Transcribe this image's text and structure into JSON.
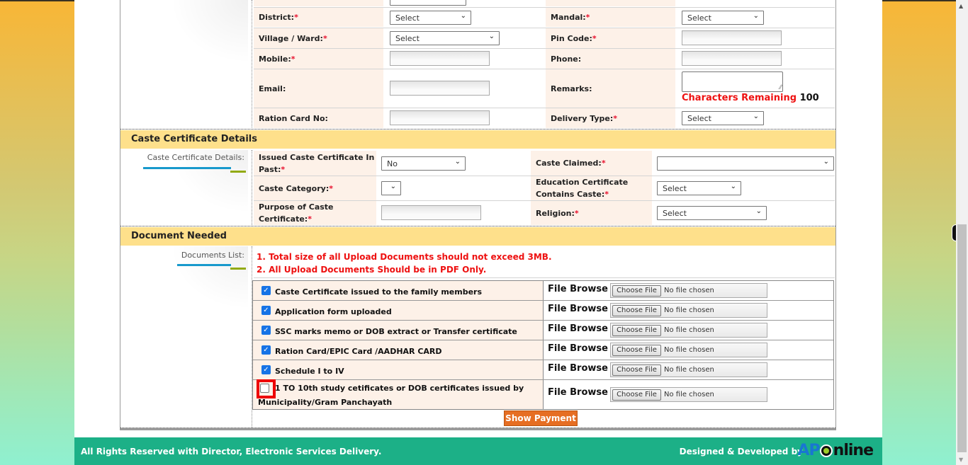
{
  "address": {
    "district": {
      "label": "District:",
      "required": "*",
      "value": "Select"
    },
    "mandal": {
      "label": "Mandal:",
      "required": "*",
      "value": "Select"
    },
    "village": {
      "label": "Village / Ward:",
      "required": "*",
      "value": "Select"
    },
    "pincode": {
      "label": "Pin Code:",
      "required": "*",
      "value": ""
    },
    "mobile": {
      "label": "Mobile:",
      "required": "*",
      "value": ""
    },
    "phone": {
      "label": "Phone:",
      "value": ""
    },
    "email": {
      "label": "Email:",
      "value": ""
    },
    "remarks": {
      "label": "Remarks:",
      "value": "",
      "chars_label": "Characters Remaining",
      "chars_count": "100"
    },
    "ration": {
      "label": "Ration Card No:",
      "value": ""
    },
    "delivery": {
      "label": "Delivery Type:",
      "required": "*",
      "value": "Select"
    }
  },
  "caste": {
    "title": "Caste Certificate Details",
    "side_label": "Caste Certificate Details:",
    "issued_past": {
      "label_line1": "Issued Caste Certificate In",
      "label_line2": "Past:",
      "required": "*",
      "value": "No"
    },
    "caste_claimed": {
      "label": "Caste Claimed:",
      "required": "*",
      "value": ""
    },
    "caste_category": {
      "label": "Caste Category:",
      "required": "*",
      "value": ""
    },
    "edu_cert": {
      "label_line1": "Education Certificate",
      "label_line2": "Contains Caste:",
      "required": "*",
      "value": "Select"
    },
    "purpose": {
      "label_line1": "Purpose of Caste",
      "label_line2": "Certificate:",
      "required": "*",
      "value": ""
    },
    "religion": {
      "label": "Religion:",
      "required": "*",
      "value": "Select"
    }
  },
  "documents": {
    "title": "Document Needed",
    "side_label": "Documents List:",
    "notes": [
      "1. Total size of all Upload Documents should not exceed 3MB.",
      "2. All Upload Documents Should be in PDF Only."
    ],
    "file_label": "File Browse :",
    "choose_label": "Choose File",
    "no_file": "No file chosen",
    "items": [
      {
        "label": "Caste Certificate issued to the family members",
        "checked": true
      },
      {
        "label": "Application form uploaded",
        "checked": true
      },
      {
        "label": "SSC marks memo or DOB extract or Transfer certificate",
        "checked": true
      },
      {
        "label": "Ration Card/EPIC Card /AADHAR CARD",
        "checked": true
      },
      {
        "label": "Schedule I to IV",
        "checked": true
      },
      {
        "label": "1 TO 10th study cetificates or DOB certificates issued by",
        "label_line2": "Municipality/Gram Panchayath",
        "checked": false
      }
    ]
  },
  "actions": {
    "show_payment": "Show Payment"
  },
  "footer": {
    "rights": "All Rights Reserved with Director, Electronic Services Delivery.",
    "designed": "Designed & Developed by",
    "logo_ap": "AP",
    "logo_online": "nline"
  },
  "icons": {
    "check": "✓",
    "chevron": "⌄",
    "resize_grip": "⁄⁄",
    "scroll_up": "▲",
    "scroll_down": "▼"
  }
}
